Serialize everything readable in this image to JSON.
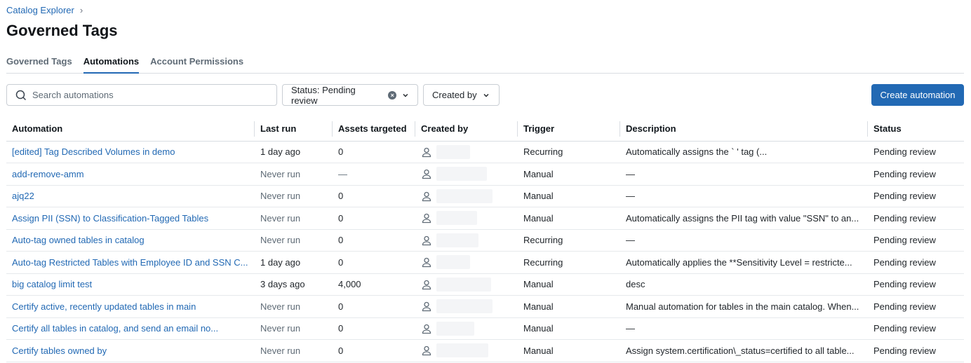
{
  "breadcrumb": {
    "parent": "Catalog Explorer",
    "separator": "›"
  },
  "page_title": "Governed Tags",
  "tabs": [
    {
      "label": "Governed Tags",
      "active": false
    },
    {
      "label": "Automations",
      "active": true
    },
    {
      "label": "Account Permissions",
      "active": false
    }
  ],
  "search": {
    "placeholder": "Search automations",
    "value": ""
  },
  "filters": {
    "status_label": "Status: Pending review",
    "created_by_label": "Created by"
  },
  "create_button": "Create automation",
  "colors": {
    "accent": "#2269b4",
    "link": "#2269b4",
    "muted": "#5f6b76"
  },
  "table": {
    "columns": [
      "Automation",
      "Last run",
      "Assets targeted",
      "Created by",
      "Trigger",
      "Description",
      "Status"
    ],
    "rows": [
      {
        "automation": "[edited] Tag Described Volumes in        demo",
        "last_run": "1 day ago",
        "assets": "0",
        "trigger": "Recurring",
        "description": "Automatically assigns the `                              ' tag (...",
        "status": "Pending review"
      },
      {
        "automation": "add-remove-amm",
        "last_run": "Never run",
        "assets": "—",
        "trigger": "Manual",
        "description": "—",
        "status": "Pending review"
      },
      {
        "automation": "ajq22",
        "last_run": "Never run",
        "assets": "0",
        "trigger": "Manual",
        "description": "—",
        "status": "Pending review"
      },
      {
        "automation": "Assign PII (SSN) to Classification-Tagged Tables",
        "last_run": "Never run",
        "assets": "0",
        "trigger": "Manual",
        "description": "Automatically assigns the PII tag with value \"SSN\" to an...",
        "status": "Pending review"
      },
      {
        "automation": "Auto-tag owned tables in        catalog",
        "last_run": "Never run",
        "assets": "0",
        "trigger": "Recurring",
        "description": "—",
        "status": "Pending review"
      },
      {
        "automation": "Auto-tag Restricted Tables with Employee ID and SSN C...",
        "last_run": "1 day ago",
        "assets": "0",
        "trigger": "Recurring",
        "description": "Automatically applies the **Sensitivity Level = restricte...",
        "status": "Pending review"
      },
      {
        "automation": "big catalog limit test",
        "last_run": "3 days ago",
        "assets": "4,000",
        "trigger": "Manual",
        "description": "desc",
        "status": "Pending review"
      },
      {
        "automation": "Certify active, recently updated tables in main",
        "last_run": "Never run",
        "assets": "0",
        "trigger": "Manual",
        "description": "Manual automation for tables in the main catalog. When...",
        "status": "Pending review"
      },
      {
        "automation": "Certify all tables in           catalog, and send an email no...",
        "last_run": "Never run",
        "assets": "0",
        "trigger": "Manual",
        "description": "—",
        "status": "Pending review"
      },
      {
        "automation": "Certify tables owned by",
        "last_run": "Never run",
        "assets": "0",
        "trigger": "Manual",
        "description": "Assign system.certification\\_status=certified to all table...",
        "status": "Pending review"
      }
    ]
  }
}
